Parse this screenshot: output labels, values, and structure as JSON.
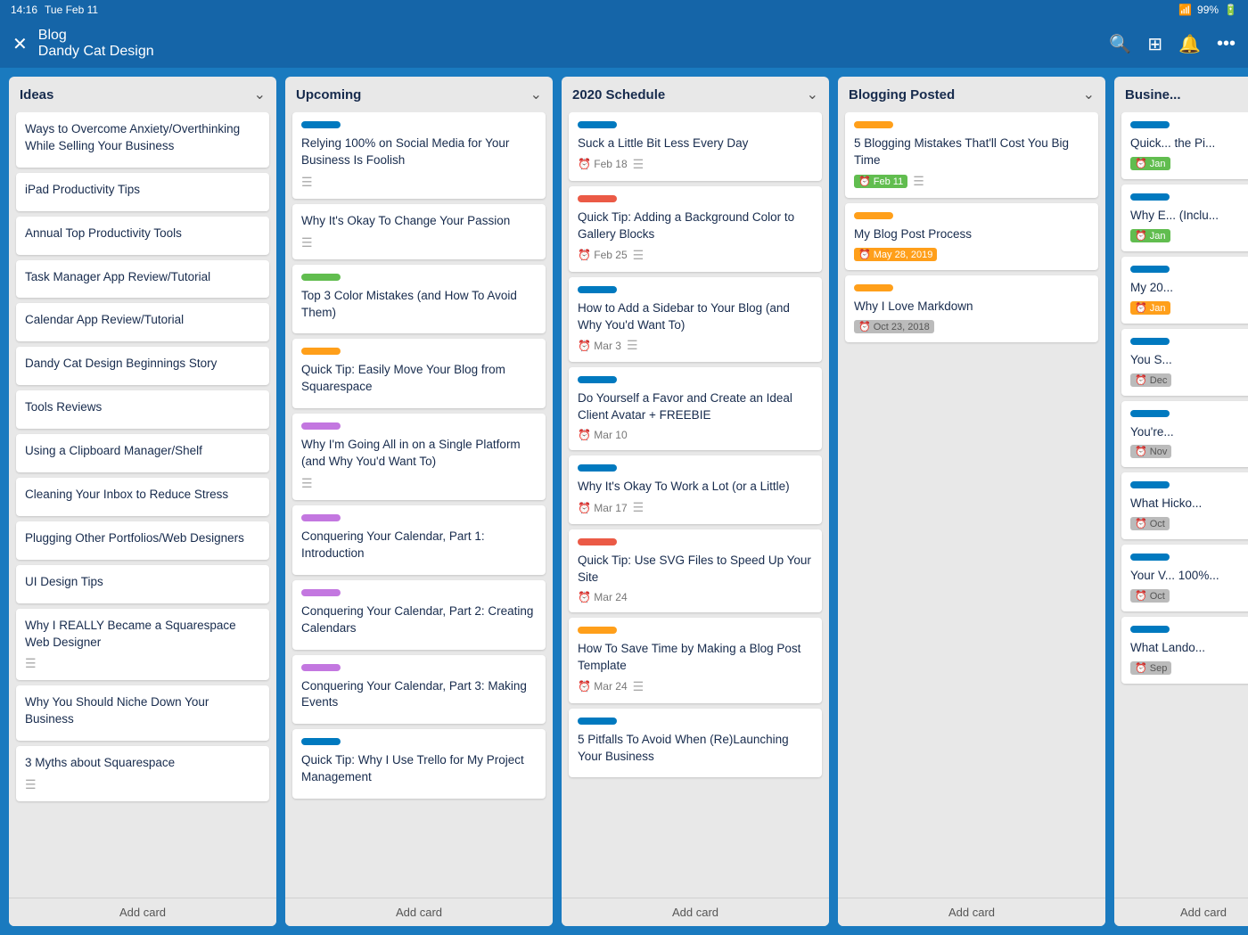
{
  "statusBar": {
    "time": "14:16",
    "date": "Tue Feb 11",
    "battery": "99%"
  },
  "header": {
    "title": "Blog",
    "subtitle": "Dandy Cat Design",
    "closeLabel": "✕",
    "icons": [
      "🔍",
      "⊞",
      "🔔",
      "•••"
    ]
  },
  "columns": [
    {
      "id": "ideas",
      "title": "Ideas",
      "cards": [
        {
          "id": "i1",
          "label": null,
          "title": "Ways to Overcome Anxiety/Overthinking While Selling Your Business",
          "meta": null
        },
        {
          "id": "i2",
          "label": null,
          "title": "iPad Productivity Tips",
          "meta": null
        },
        {
          "id": "i3",
          "label": null,
          "title": "Annual Top Productivity Tools",
          "meta": null
        },
        {
          "id": "i4",
          "label": null,
          "title": "Task Manager App Review/Tutorial",
          "meta": null
        },
        {
          "id": "i5",
          "label": null,
          "title": "Calendar App Review/Tutorial",
          "meta": null
        },
        {
          "id": "i6",
          "label": null,
          "title": "Dandy Cat Design Beginnings Story",
          "meta": null
        },
        {
          "id": "i7",
          "label": null,
          "title": "Tools Reviews",
          "meta": null
        },
        {
          "id": "i8",
          "label": null,
          "title": "Using a Clipboard Manager/Shelf",
          "meta": null
        },
        {
          "id": "i9",
          "label": null,
          "title": "Cleaning Your Inbox to Reduce Stress",
          "meta": null
        },
        {
          "id": "i10",
          "label": null,
          "title": "Plugging Other Portfolios/Web Designers",
          "meta": null
        },
        {
          "id": "i11",
          "label": null,
          "title": "UI Design Tips",
          "meta": null
        },
        {
          "id": "i12",
          "label": null,
          "title": "Why I REALLY Became a Squarespace Web Designer",
          "hasDivider": true,
          "meta": null
        },
        {
          "id": "i13",
          "label": null,
          "title": "Why You Should Niche Down Your Business",
          "meta": null
        },
        {
          "id": "i14",
          "label": null,
          "title": "3 Myths about Squarespace",
          "hasDivider": true,
          "meta": null
        }
      ],
      "addCard": "Add card"
    },
    {
      "id": "upcoming",
      "title": "Upcoming",
      "cards": [
        {
          "id": "u1",
          "label": "blue",
          "title": "Relying 100% on Social Media for Your Business Is Foolish",
          "hasDivider": true,
          "meta": null
        },
        {
          "id": "u2",
          "label": null,
          "title": "Why It's Okay To Change Your Passion",
          "hasDivider": true,
          "meta": null
        },
        {
          "id": "u3",
          "label": "green",
          "title": "Top 3 Color Mistakes (and How To Avoid Them)",
          "meta": null
        },
        {
          "id": "u4",
          "label": "orange",
          "title": "Quick Tip: Easily Move Your Blog from Squarespace",
          "meta": null
        },
        {
          "id": "u5",
          "label": "purple",
          "title": "Why I'm Going All in on a Single Platform (and Why You'd Want To)",
          "hasDivider": true,
          "meta": null
        },
        {
          "id": "u6",
          "label": "purple",
          "title": "Conquering Your Calendar, Part 1: Introduction",
          "meta": null
        },
        {
          "id": "u7",
          "label": "purple",
          "title": "Conquering Your Calendar, Part 2: Creating Calendars",
          "meta": null
        },
        {
          "id": "u8",
          "label": "purple",
          "title": "Conquering Your Calendar, Part 3: Making Events",
          "meta": null
        },
        {
          "id": "u9",
          "label": "blue",
          "title": "Quick Tip: Why I Use Trello for My Project Management",
          "meta": null
        }
      ],
      "addCard": "Add card"
    },
    {
      "id": "schedule2020",
      "title": "2020 Schedule",
      "cards": [
        {
          "id": "s1",
          "label": "blue",
          "title": "Suck a Little Bit Less Every Day",
          "meta": {
            "date": "Feb 18",
            "hasLines": true
          }
        },
        {
          "id": "s2",
          "label": "red",
          "title": "Quick Tip: Adding a Background Color to Gallery Blocks",
          "meta": {
            "date": "Feb 25",
            "hasLines": true
          }
        },
        {
          "id": "s3",
          "label": "blue",
          "title": "How to Add a Sidebar to Your Blog (and Why You'd Want To)",
          "meta": {
            "date": "Mar 3",
            "hasLines": true
          }
        },
        {
          "id": "s4",
          "label": "blue",
          "title": "Do Yourself a Favor and Create an Ideal Client Avatar + FREEBIE",
          "meta": {
            "date": "Mar 10",
            "clock": true
          }
        },
        {
          "id": "s5",
          "label": "blue",
          "title": "Why It's Okay To Work a Lot (or a Little)",
          "meta": {
            "date": "Mar 17",
            "hasLines": true
          }
        },
        {
          "id": "s6",
          "label": "red",
          "title": "Quick Tip: Use SVG Files to Speed Up Your Site",
          "meta": {
            "date": "Mar 24",
            "clock": true
          }
        },
        {
          "id": "s7",
          "label": "orange",
          "title": "How To Save Time by Making a Blog Post Template",
          "meta": {
            "date": "Mar 24",
            "hasLines": true
          }
        },
        {
          "id": "s8",
          "label": "blue",
          "title": "5 Pitfalls To Avoid When (Re)Launching Your Business",
          "meta": null
        }
      ],
      "addCard": "Add card"
    },
    {
      "id": "bloggingPosted",
      "title": "Blogging Posted",
      "cards": [
        {
          "id": "b1",
          "label": "orange",
          "title": "5 Blogging Mistakes That'll Cost You Big Time",
          "meta": {
            "badge": "Feb 11",
            "badgeColor": "green",
            "hasLines": true
          }
        },
        {
          "id": "b2",
          "label": "orange",
          "title": "My Blog Post Process",
          "meta": {
            "badge": "May 28, 2019",
            "badgeColor": "orange"
          }
        },
        {
          "id": "b3",
          "label": "orange",
          "title": "Why I Love Markdown",
          "meta": {
            "badge": "Oct 23, 2018",
            "badgeColor": "past"
          }
        }
      ],
      "addCard": "Add card"
    },
    {
      "id": "business",
      "title": "Busine...",
      "cards": [
        {
          "id": "bs1",
          "label": "blue",
          "title": "Quick... the Pi...",
          "meta": {
            "badge": "Jan",
            "badgeColor": "green"
          }
        },
        {
          "id": "bs2",
          "label": "blue",
          "title": "Why E... (Inclu...",
          "meta": {
            "badge": "Jan",
            "badgeColor": "green"
          }
        },
        {
          "id": "bs3",
          "label": "blue",
          "title": "My 20...",
          "meta": {
            "badge": "Jan",
            "badgeColor": "orange"
          }
        },
        {
          "id": "bs4",
          "label": "blue",
          "title": "You S...",
          "meta": {
            "badge": "Dec",
            "badgeColor": "past"
          }
        },
        {
          "id": "bs5",
          "label": "blue",
          "title": "You're...",
          "meta": {
            "badge": "Nov",
            "badgeColor": "past"
          }
        },
        {
          "id": "bs6",
          "label": "blue",
          "title": "What Hicko...",
          "meta": {
            "badge": "Oct",
            "badgeColor": "past"
          }
        },
        {
          "id": "bs7",
          "label": "blue",
          "title": "Your V... 100%...",
          "meta": {
            "badge": "Oct",
            "badgeColor": "past"
          }
        },
        {
          "id": "bs8",
          "label": "blue",
          "title": "What Lando...",
          "meta": {
            "badge": "Sep",
            "badgeColor": "past"
          }
        }
      ],
      "addCard": "Add card"
    }
  ]
}
